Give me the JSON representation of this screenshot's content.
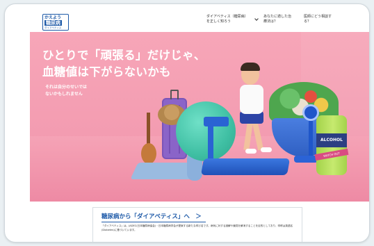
{
  "logo": {
    "line1": "かえよう",
    "line2": "糖尿病",
    "line3": "ダイアベティス"
  },
  "nav": {
    "item1": "ダイアベティス（糖尿病）を正しく知ろう",
    "item2": "あなたに適した治療法は？",
    "item3": "医師にどう相談する？"
  },
  "hero": {
    "headline_line1": "ひとりで「頑張る」だけじゃ、",
    "headline_line2": "血糖値は下がらないかも",
    "subtext_line1": "それは自分のせいでは",
    "subtext_line2": "ないかもしれません",
    "can_label": "ALCOHOL",
    "can_band": "WATCH OUT"
  },
  "card": {
    "title": "糖尿病から「ダイアベティス」へ　＞",
    "text": "「ダイアベティス」は、JADEC(日本糖尿病協会)・日本糖尿病学会が提案する新たな呼び名です。病気に対する誤解や偏見を解消することを目的としており、呼称は英語名(Diabetes)に基づいています。"
  },
  "colors": {
    "hero_pink": "#f39cb1",
    "brand_blue": "#1e5aa8"
  }
}
